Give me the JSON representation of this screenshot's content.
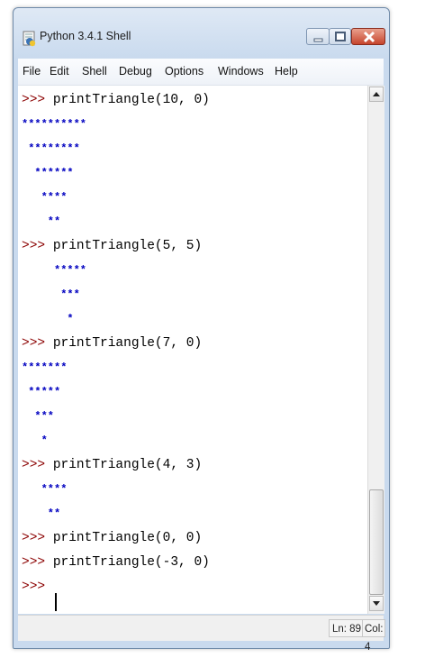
{
  "window": {
    "title": "Python 3.4.1 Shell",
    "controls": {
      "minimize": "minimize-icon",
      "maximize": "maximize-icon",
      "close": "close-icon"
    }
  },
  "menu": [
    "File",
    "Edit",
    "Shell",
    "Debug",
    "Options",
    "Windows",
    "Help"
  ],
  "shell": {
    "lines": [
      {
        "prompt": ">>> ",
        "text": "printTriangle(10, 0)"
      },
      {
        "text": "**********"
      },
      {
        "text": " ********"
      },
      {
        "text": "  ******"
      },
      {
        "text": "   ****"
      },
      {
        "text": "    **"
      },
      {
        "prompt": ">>> ",
        "text": "printTriangle(5, 5)"
      },
      {
        "text": "     *****"
      },
      {
        "text": "      ***"
      },
      {
        "text": "       *"
      },
      {
        "prompt": ">>> ",
        "text": "printTriangle(7, 0)"
      },
      {
        "text": "*******"
      },
      {
        "text": " *****"
      },
      {
        "text": "  ***"
      },
      {
        "text": "   *"
      },
      {
        "prompt": ">>> ",
        "text": "printTriangle(4, 3)"
      },
      {
        "text": "   ****"
      },
      {
        "text": "    **"
      },
      {
        "prompt": ">>> ",
        "text": "printTriangle(0, 0)"
      },
      {
        "prompt": ">>> ",
        "text": "printTriangle(-3, 0)"
      },
      {
        "prompt": ">>> ",
        "text": ""
      }
    ]
  },
  "status": {
    "line": "Ln: 89",
    "col": "Col: 4"
  },
  "colors": {
    "prompt": "#8b0000",
    "output": "#0000c0",
    "titlebar": "#c9daee"
  }
}
